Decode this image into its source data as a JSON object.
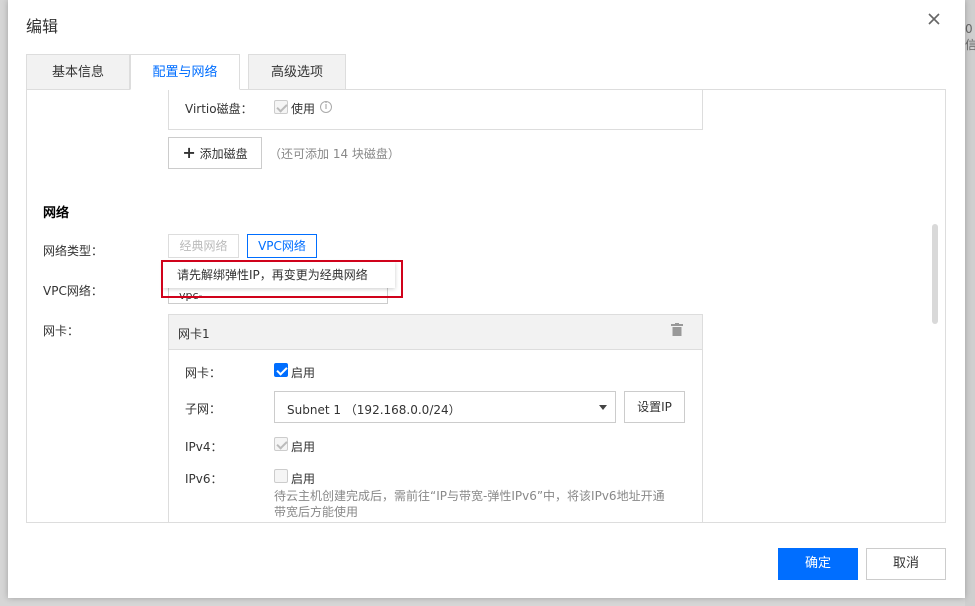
{
  "background": {
    "right_text": "0信"
  },
  "dialog": {
    "title": "编辑",
    "tabs": [
      {
        "label": "基本信息"
      },
      {
        "label": "配置与网络"
      },
      {
        "label": "高级选项"
      }
    ],
    "disk": {
      "virtio_label": "Virtio磁盘：",
      "use_label": "使用",
      "add_disk_label": "添加磁盘",
      "add_disk_hint": "（还可添加 14 块磁盘）"
    },
    "network": {
      "section_title": "网络",
      "type_label": "网络类型：",
      "type_options": [
        "经典网络",
        "VPC网络"
      ],
      "vpc_label": "VPC网络：",
      "vpc_value_partial": "vpc-",
      "tooltip": "请先解绑弹性IP，再变更为经典网络",
      "nic_label": "网卡：",
      "nic_card": {
        "title": "网卡1",
        "enable_label": "网卡：",
        "enable_text": "启用",
        "subnet_label": "子网：",
        "subnet_value": "Subnet 1 （192.168.0.0/24）",
        "set_ip_label": "设置IP",
        "ipv4_label": "IPv4：",
        "ipv4_text": "启用",
        "ipv6_label": "IPv6：",
        "ipv6_text": "启用",
        "ipv6_hint_1": "待云主机创建完成后，需前往“IP与带宽-弹性IPv6”中，将该IPv6地址开通",
        "ipv6_hint_2": "带宽后方能使用"
      }
    },
    "footer": {
      "confirm_label": "确定",
      "cancel_label": "取消"
    }
  },
  "colors": {
    "primary": "#006eff",
    "highlight_box": "#d0021b"
  }
}
